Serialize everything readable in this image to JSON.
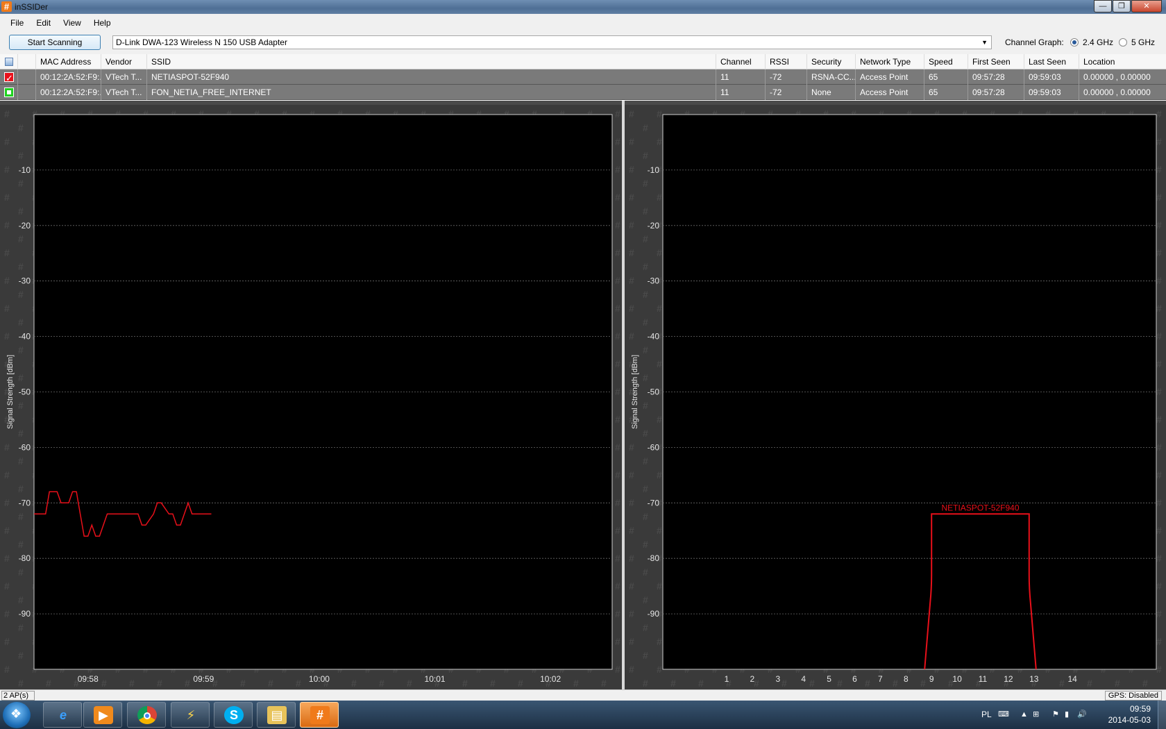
{
  "window": {
    "title": "inSSIDer",
    "app_icon": "#",
    "minimize": "—",
    "maximize": "❐",
    "close": "✕"
  },
  "menu": [
    "File",
    "Edit",
    "View",
    "Help"
  ],
  "toolbar": {
    "start_label": "Start Scanning",
    "adapter": "D-Link DWA-123 Wireless N 150 USB Adapter",
    "channel_graph_label": "Channel Graph:",
    "band_24": "2.4 GHz",
    "band_5": "5 GHz",
    "selected_band": "2.4 GHz"
  },
  "grid": {
    "columns": [
      "MAC Address",
      "Vendor",
      "SSID",
      "Channel",
      "RSSI",
      "Security",
      "Network Type",
      "Speed",
      "First Seen",
      "Last Seen",
      "Location"
    ],
    "rows": [
      {
        "color": "#e8101a",
        "checked": true,
        "mac": "00:12:2A:52:F9:...",
        "vendor": "VTech T...",
        "ssid": "NETIASPOT-52F940",
        "channel": "11",
        "rssi": "-72",
        "security": "RSNA-CC...",
        "network_type": "Access Point",
        "speed": "65",
        "first_seen": "09:57:28",
        "last_seen": "09:59:03",
        "location": "0.00000 , 0.00000"
      },
      {
        "color": "#1fd21f",
        "checked": false,
        "mac": "00:12:2A:52:F9:...",
        "vendor": "VTech T...",
        "ssid": "FON_NETIA_FREE_INTERNET",
        "channel": "11",
        "rssi": "-72",
        "security": "None",
        "network_type": "Access Point",
        "speed": "65",
        "first_seen": "09:57:28",
        "last_seen": "09:59:03",
        "location": "0.00000 , 0.00000"
      }
    ]
  },
  "chart_data": [
    {
      "type": "line",
      "name": "time-graph",
      "ylabel": "Signal Strength [dBm]",
      "ylim": [
        -100,
        0
      ],
      "yticks": [
        -10,
        -20,
        -30,
        -40,
        -50,
        -60,
        -70,
        -80,
        -90
      ],
      "xticks": [
        "09:58",
        "09:59",
        "10:00",
        "10:01",
        "10:02"
      ],
      "xlim": [
        "09:57:32",
        "10:02:32"
      ],
      "grid": true,
      "series": [
        {
          "color": "#e8101a",
          "x": [
            "09:57:32",
            "09:57:38",
            "09:57:40",
            "09:57:44",
            "09:57:46",
            "09:57:50",
            "09:57:52",
            "09:57:54",
            "09:57:56",
            "09:57:58",
            "09:58:00",
            "09:58:02",
            "09:58:04",
            "09:58:06",
            "09:58:10",
            "09:58:18",
            "09:58:20",
            "09:58:26",
            "09:58:28",
            "09:58:30",
            "09:58:34",
            "09:58:36",
            "09:58:38",
            "09:58:42",
            "09:58:44",
            "09:58:46",
            "09:58:48",
            "09:58:52",
            "09:58:54",
            "09:59:04"
          ],
          "values": [
            -72,
            -72,
            -68,
            -68,
            -70,
            -70,
            -68,
            -68,
            -72,
            -76,
            -76,
            -74,
            -76,
            -76,
            -72,
            -72,
            -72,
            -72,
            -74,
            -74,
            -72,
            -70,
            -70,
            -72,
            -72,
            -74,
            -74,
            -70,
            -72,
            -72
          ]
        }
      ]
    },
    {
      "type": "area",
      "name": "channel-graph",
      "ylabel": "Signal Strength [dBm]",
      "ylim": [
        -100,
        0
      ],
      "yticks": [
        -10,
        -20,
        -30,
        -40,
        -50,
        -60,
        -70,
        -80,
        -90
      ],
      "xticks": [
        "1",
        "2",
        "3",
        "4",
        "5",
        "6",
        "7",
        "8",
        "9",
        "10",
        "11",
        "12",
        "13",
        "14"
      ],
      "grid": true,
      "series": [
        {
          "name": "NETIASPOT-52F940",
          "color": "#e8101a",
          "channel_from": 9,
          "channel_to": 13,
          "center": 11,
          "value": -72
        }
      ]
    }
  ],
  "statusbar": {
    "left": "2 AP(s)",
    "right": "GPS: Disabled"
  },
  "taskbar": {
    "apps": [
      "ie-icon",
      "media-player-icon",
      "chrome-icon",
      "power-shield-icon",
      "skype-icon",
      "explorer-icon",
      "inssider-icon"
    ],
    "lang": "PL",
    "time": "09:59",
    "date": "2014-05-03"
  }
}
